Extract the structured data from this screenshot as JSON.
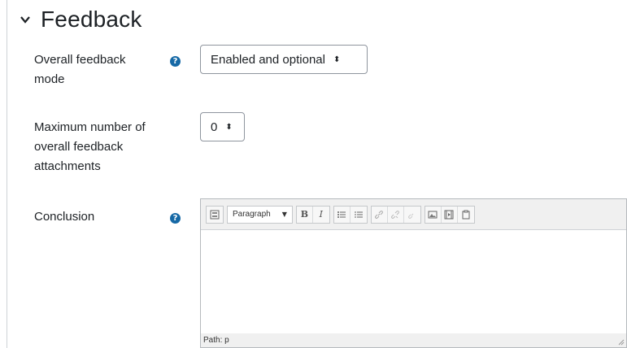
{
  "section": {
    "title": "Feedback",
    "icon": "chevron-down-icon"
  },
  "fields": {
    "overall_feedback_mode": {
      "label_line1": "Overall feedback",
      "label_line2": "mode",
      "value": "Enabled and optional"
    },
    "max_attachments": {
      "label_line1": "Maximum number of",
      "label_line2": "overall feedback",
      "label_line3": "attachments",
      "value": "0"
    },
    "conclusion": {
      "label": "Conclusion",
      "editor": {
        "format_value": "Paragraph",
        "toolbar_icons": [
          "toggle-toolbar-icon",
          "bold-icon",
          "italic-icon",
          "unordered-list-icon",
          "ordered-list-icon",
          "link-icon",
          "unlink-icon",
          "anchor-icon",
          "image-icon",
          "media-icon",
          "paste-icon"
        ],
        "bold_label": "B",
        "italic_label": "I",
        "path_text": "Path: p"
      }
    }
  },
  "colors": {
    "help_icon": "#1669a6",
    "border": "#8f959e"
  }
}
